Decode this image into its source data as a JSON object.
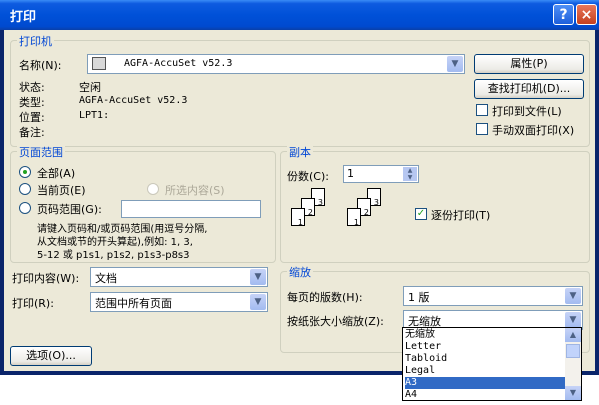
{
  "window": {
    "title": "打印",
    "help_label": "?",
    "close_label": "×"
  },
  "printer": {
    "group_title": "打印机",
    "name_label": "名称(N):",
    "name_value": "AGFA-AccuSet v52.3",
    "status_label": "状态:",
    "status_value": "空闲",
    "type_label": "类型:",
    "type_value": "AGFA-AccuSet v52.3",
    "location_label": "位置:",
    "location_value": "LPT1:",
    "comment_label": "备注:",
    "properties_button": "属性(P)",
    "find_printer_button": "查找打印机(D)...",
    "print_to_file": "打印到文件(L)",
    "manual_duplex": "手动双面打印(X)"
  },
  "page_range": {
    "group_title": "页面范围",
    "all": "全部(A)",
    "current": "当前页(E)",
    "selection": "所选内容(S)",
    "pages": "页码范围(G):",
    "hint_line1": "请键入页码和/或页码范围(用逗号分隔,",
    "hint_line2": "从文档或节的开头算起),例如: 1, 3,",
    "hint_line3": "5-12 或 p1s1, p1s2, p1s3-p8s3"
  },
  "copies": {
    "group_title": "副本",
    "count_label": "份数(C):",
    "count_value": "1",
    "collate_label": "逐份打印(T)",
    "collate_checked": true,
    "page_nums": [
      "1",
      "2",
      "3"
    ]
  },
  "print_what": {
    "label": "打印内容(W):",
    "value": "文档"
  },
  "print": {
    "label": "打印(R):",
    "value": "范围中所有页面"
  },
  "zoom": {
    "group_title": "缩放",
    "pages_per_sheet_label": "每页的版数(H):",
    "pages_per_sheet_value": "1 版",
    "scale_label": "按纸张大小缩放(Z):",
    "scale_value": "无缩放",
    "scale_options": [
      "无缩放",
      "Letter",
      "Tabloid",
      "Legal",
      "A3",
      "A4"
    ],
    "selected_option": "A3"
  },
  "options_button": "选项(O)...",
  "check_mark": "✓",
  "arrow_down": "▼",
  "arrow_up": "▲"
}
